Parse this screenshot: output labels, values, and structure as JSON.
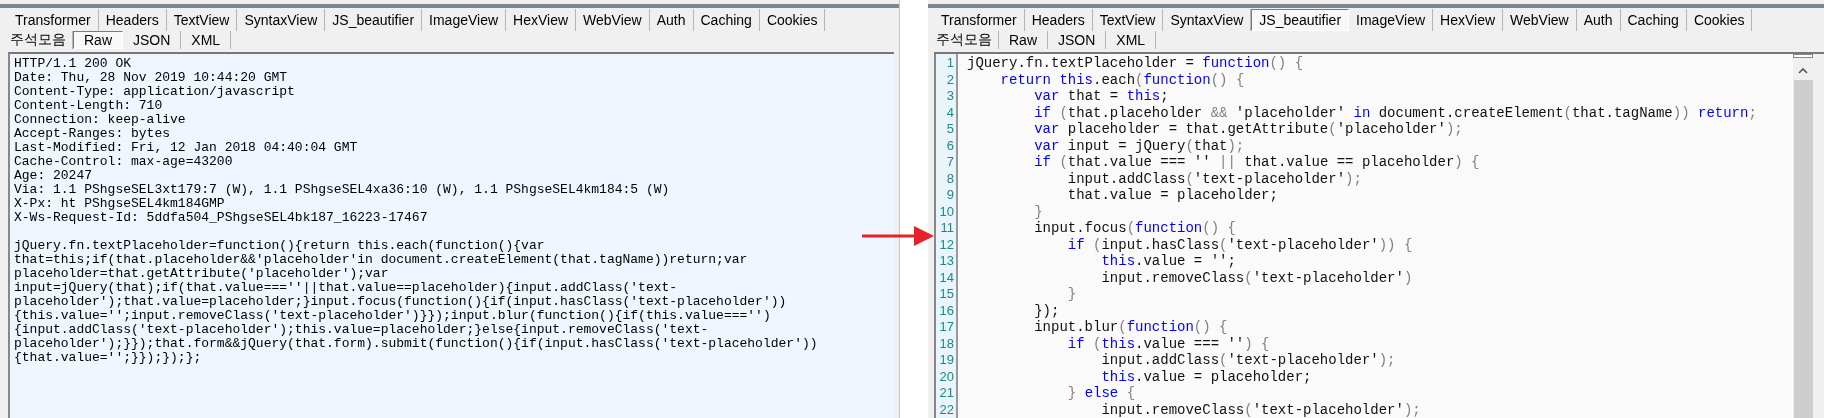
{
  "panels": [
    {
      "tabs": [
        {
          "label": "Transformer",
          "selected": false
        },
        {
          "label": "Headers",
          "selected": false
        },
        {
          "label": "TextView",
          "selected": false
        },
        {
          "label": "SyntaxView",
          "selected": false
        },
        {
          "label": "JS_beautifier",
          "selected": false
        },
        {
          "label": "ImageView",
          "selected": false
        },
        {
          "label": "HexView",
          "selected": false
        },
        {
          "label": "WebView",
          "selected": false
        },
        {
          "label": "Auth",
          "selected": false
        },
        {
          "label": "Caching",
          "selected": false
        },
        {
          "label": "Cookies",
          "selected": false
        }
      ],
      "subtabs": [
        {
          "label": "주석모음",
          "selected": false
        },
        {
          "label": "Raw",
          "selected": true
        },
        {
          "label": "JSON",
          "selected": false
        },
        {
          "label": "XML",
          "selected": false
        }
      ],
      "kind": "raw",
      "raw": {
        "headers": [
          "HTTP/1.1 200 OK",
          "Date: Thu, 28 Nov 2019 10:44:20 GMT",
          "Content-Type: application/javascript",
          "Content-Length: 710",
          "Connection: keep-alive",
          "Accept-Ranges: bytes",
          "Last-Modified: Fri, 12 Jan 2018 04:40:04 GMT",
          "Cache-Control: max-age=43200",
          "Age: 20247",
          "Via: 1.1 PShgseSEL3xt179:7 (W), 1.1 PShgseSEL4xa36:10 (W), 1.1 PShgseSEL4km184:5 (W)",
          "X-Px: ht PShgseSEL4km184GMP",
          "X-Ws-Request-Id: 5ddfa504_PShgseSEL4bk187_16223-17467"
        ],
        "body": [
          "jQuery.fn.textPlaceholder=function(){return this.each(function(){var",
          "that=this;if(that.placeholder&&'placeholder'in document.createElement(that.tagName))return;var",
          "placeholder=that.getAttribute('placeholder');var",
          "input=jQuery(that);if(that.value===''||that.value==placeholder){input.addClass('text-",
          "placeholder');that.value=placeholder;}input.focus(function(){if(input.hasClass('text-placeholder'))",
          "{this.value='';input.removeClass('text-placeholder')}});input.blur(function(){if(this.value==='')",
          "{input.addClass('text-placeholder');this.value=placeholder;}else{input.removeClass('text-",
          "placeholder');}});that.form&&jQuery(that.form).submit(function(){if(input.hasClass('text-placeholder'))",
          "{that.value='';}});});};"
        ]
      }
    },
    {
      "tabs": [
        {
          "label": "Transformer",
          "selected": false
        },
        {
          "label": "Headers",
          "selected": false
        },
        {
          "label": "TextView",
          "selected": false
        },
        {
          "label": "SyntaxView",
          "selected": false
        },
        {
          "label": "JS_beautifier",
          "selected": true
        },
        {
          "label": "ImageView",
          "selected": false
        },
        {
          "label": "HexView",
          "selected": false
        },
        {
          "label": "WebView",
          "selected": false
        },
        {
          "label": "Auth",
          "selected": false
        },
        {
          "label": "Caching",
          "selected": false
        },
        {
          "label": "Cookies",
          "selected": false
        }
      ],
      "subtabs": [
        {
          "label": "주석모음",
          "selected": false
        },
        {
          "label": "Raw",
          "selected": false
        },
        {
          "label": "JSON",
          "selected": false
        },
        {
          "label": "XML",
          "selected": false
        }
      ],
      "kind": "code",
      "code": [
        {
          "number": "1",
          "tokens": [
            {
              "text": "jQuery.fn.textPlaceholder = ",
              "kind": "plain"
            },
            {
              "text": "function",
              "kind": "keyword"
            },
            {
              "text": "() {",
              "kind": "punct"
            }
          ]
        },
        {
          "number": "2",
          "tokens": [
            {
              "text": "    return this",
              "kind": "keyword"
            },
            {
              "text": ".each",
              "kind": "plain"
            },
            {
              "text": "(",
              "kind": "punct"
            },
            {
              "text": "function",
              "kind": "keyword"
            },
            {
              "text": "() {",
              "kind": "punct"
            }
          ]
        },
        {
          "number": "3",
          "tokens": [
            {
              "text": "        var",
              "kind": "keyword"
            },
            {
              "text": " that = ",
              "kind": "plain"
            },
            {
              "text": "this",
              "kind": "keyword"
            },
            {
              "text": ";",
              "kind": "plain"
            }
          ]
        },
        {
          "number": "4",
          "tokens": [
            {
              "text": "        if",
              "kind": "keyword"
            },
            {
              "text": " (",
              "kind": "punct"
            },
            {
              "text": "that.placeholder ",
              "kind": "plain"
            },
            {
              "text": "&&",
              "kind": "punct"
            },
            {
              "text": " 'placeholder' ",
              "kind": "plain"
            },
            {
              "text": "in",
              "kind": "keyword"
            },
            {
              "text": " document.createElement",
              "kind": "plain"
            },
            {
              "text": "(",
              "kind": "punct"
            },
            {
              "text": "that.tagName",
              "kind": "plain"
            },
            {
              "text": "))",
              "kind": "punct"
            },
            {
              "text": " return",
              "kind": "keyword"
            },
            {
              "text": ";",
              "kind": "punct"
            }
          ]
        },
        {
          "number": "5",
          "tokens": [
            {
              "text": "        var",
              "kind": "keyword"
            },
            {
              "text": " placeholder = that.getAttribute",
              "kind": "plain"
            },
            {
              "text": "(",
              "kind": "punct"
            },
            {
              "text": "'placeholder'",
              "kind": "plain"
            },
            {
              "text": ");",
              "kind": "punct"
            }
          ]
        },
        {
          "number": "6",
          "tokens": [
            {
              "text": "        var",
              "kind": "keyword"
            },
            {
              "text": " input = jQuery",
              "kind": "plain"
            },
            {
              "text": "(",
              "kind": "punct"
            },
            {
              "text": "that",
              "kind": "plain"
            },
            {
              "text": ");",
              "kind": "punct"
            }
          ]
        },
        {
          "number": "7",
          "tokens": [
            {
              "text": "        if",
              "kind": "keyword"
            },
            {
              "text": " (",
              "kind": "punct"
            },
            {
              "text": "that.value === '' ",
              "kind": "plain"
            },
            {
              "text": "||",
              "kind": "punct"
            },
            {
              "text": " that.value == placeholder",
              "kind": "plain"
            },
            {
              "text": ") {",
              "kind": "punct"
            }
          ]
        },
        {
          "number": "8",
          "tokens": [
            {
              "text": "            input.addClass",
              "kind": "plain"
            },
            {
              "text": "(",
              "kind": "punct"
            },
            {
              "text": "'text-placeholder'",
              "kind": "plain"
            },
            {
              "text": ");",
              "kind": "punct"
            }
          ]
        },
        {
          "number": "9",
          "tokens": [
            {
              "text": "            that.value = placeholder;",
              "kind": "plain"
            }
          ]
        },
        {
          "number": "10",
          "tokens": [
            {
              "text": "        }",
              "kind": "punct"
            }
          ]
        },
        {
          "number": "11",
          "tokens": [
            {
              "text": "        input.focus",
              "kind": "plain"
            },
            {
              "text": "(",
              "kind": "punct"
            },
            {
              "text": "function",
              "kind": "keyword"
            },
            {
              "text": "() {",
              "kind": "punct"
            }
          ]
        },
        {
          "number": "12",
          "tokens": [
            {
              "text": "            if",
              "kind": "keyword"
            },
            {
              "text": " (",
              "kind": "punct"
            },
            {
              "text": "input.hasClass",
              "kind": "plain"
            },
            {
              "text": "(",
              "kind": "punct"
            },
            {
              "text": "'text-placeholder'",
              "kind": "plain"
            },
            {
              "text": ")) {",
              "kind": "punct"
            }
          ]
        },
        {
          "number": "13",
          "tokens": [
            {
              "text": "                this",
              "kind": "keyword"
            },
            {
              "text": ".value = '';",
              "kind": "plain"
            }
          ]
        },
        {
          "number": "14",
          "tokens": [
            {
              "text": "                input.removeClass",
              "kind": "plain"
            },
            {
              "text": "(",
              "kind": "punct"
            },
            {
              "text": "'text-placeholder'",
              "kind": "plain"
            },
            {
              "text": ")",
              "kind": "punct"
            }
          ]
        },
        {
          "number": "15",
          "tokens": [
            {
              "text": "            }",
              "kind": "punct"
            }
          ]
        },
        {
          "number": "16",
          "tokens": [
            {
              "text": "        });",
              "kind": "plain"
            }
          ]
        },
        {
          "number": "17",
          "tokens": [
            {
              "text": "        input.blur",
              "kind": "plain"
            },
            {
              "text": "(",
              "kind": "punct"
            },
            {
              "text": "function",
              "kind": "keyword"
            },
            {
              "text": "() {",
              "kind": "punct"
            }
          ]
        },
        {
          "number": "18",
          "tokens": [
            {
              "text": "            if",
              "kind": "keyword"
            },
            {
              "text": " (",
              "kind": "punct"
            },
            {
              "text": "this",
              "kind": "keyword"
            },
            {
              "text": ".value === ''",
              "kind": "plain"
            },
            {
              "text": ") {",
              "kind": "punct"
            }
          ]
        },
        {
          "number": "19",
          "tokens": [
            {
              "text": "                input.addClass",
              "kind": "plain"
            },
            {
              "text": "(",
              "kind": "punct"
            },
            {
              "text": "'text-placeholder'",
              "kind": "plain"
            },
            {
              "text": ");",
              "kind": "punct"
            }
          ]
        },
        {
          "number": "20",
          "tokens": [
            {
              "text": "                this",
              "kind": "keyword"
            },
            {
              "text": ".value = placeholder;",
              "kind": "plain"
            }
          ]
        },
        {
          "number": "21",
          "tokens": [
            {
              "text": "            } ",
              "kind": "punct"
            },
            {
              "text": "else",
              "kind": "keyword"
            },
            {
              "text": " {",
              "kind": "punct"
            }
          ]
        },
        {
          "number": "22",
          "tokens": [
            {
              "text": "                input.removeClass",
              "kind": "plain"
            },
            {
              "text": "(",
              "kind": "punct"
            },
            {
              "text": "'text-placeholder'",
              "kind": "plain"
            },
            {
              "text": ");",
              "kind": "punct"
            }
          ]
        }
      ]
    }
  ]
}
